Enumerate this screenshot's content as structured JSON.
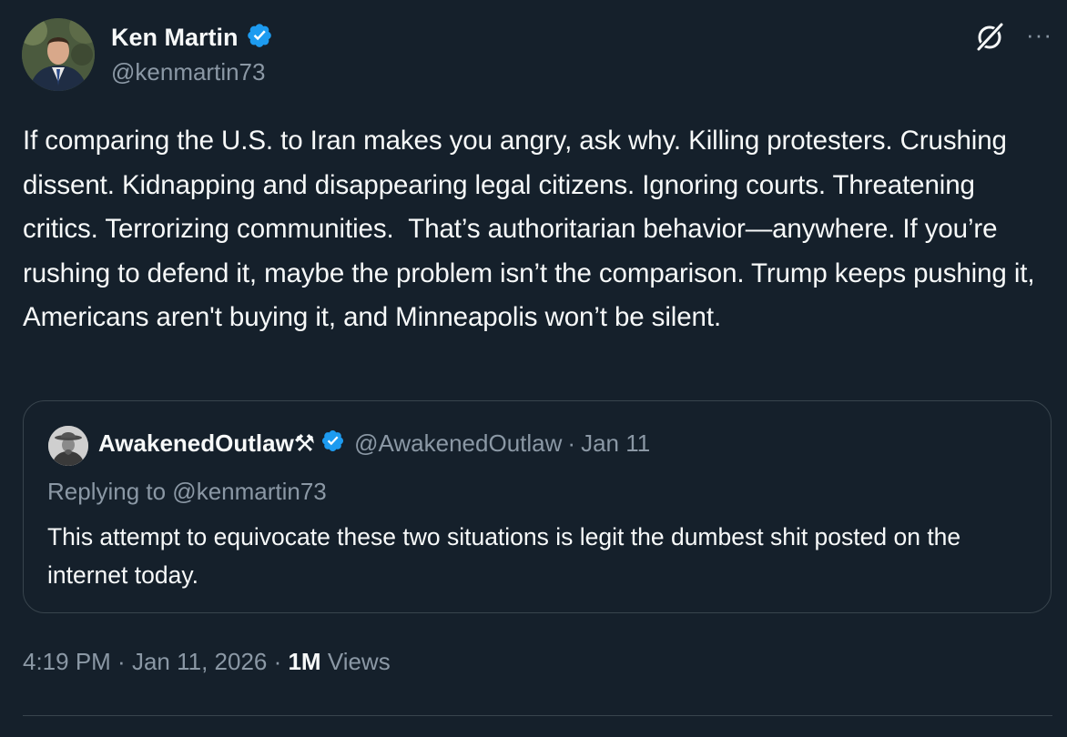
{
  "author": {
    "display_name": "Ken Martin",
    "handle": "@kenmartin73",
    "verified_icon": "verified-badge-icon"
  },
  "tweet": {
    "text": "If comparing the U.S. to Iran makes you angry, ask why. Killing protesters. Crushing dissent. Kidnapping and disappearing legal citizens. Ignoring courts. Threatening critics. Terrorizing communities.  That’s authoritarian behavior—anywhere. If you’re rushing to defend it, maybe the problem isn’t the comparison. Trump keeps pushing it, Americans aren't buying it, and Minneapolis won’t be silent."
  },
  "quoted_tweet": {
    "display_name": "AwakenedOutlaw⚒",
    "handle": "@AwakenedOutlaw",
    "separator": "·",
    "date": "Jan 11",
    "replying_to": "Replying to @kenmartin73",
    "text": "This attempt to equivocate these two situations is legit the dumbest shit posted on the internet today."
  },
  "meta": {
    "time": "4:19 PM",
    "separator": " · ",
    "date": "Jan 11, 2026",
    "views_count": "1M",
    "views_label": "Views"
  },
  "icons": {
    "grok": "grok-icon",
    "more": "more-icon",
    "verified": "verified-badge-icon"
  },
  "colors": {
    "background": "#15202b",
    "text": "#f7f9f9",
    "secondary": "#8b98a5",
    "verified": "#1d9bf0",
    "border": "#38444d"
  }
}
